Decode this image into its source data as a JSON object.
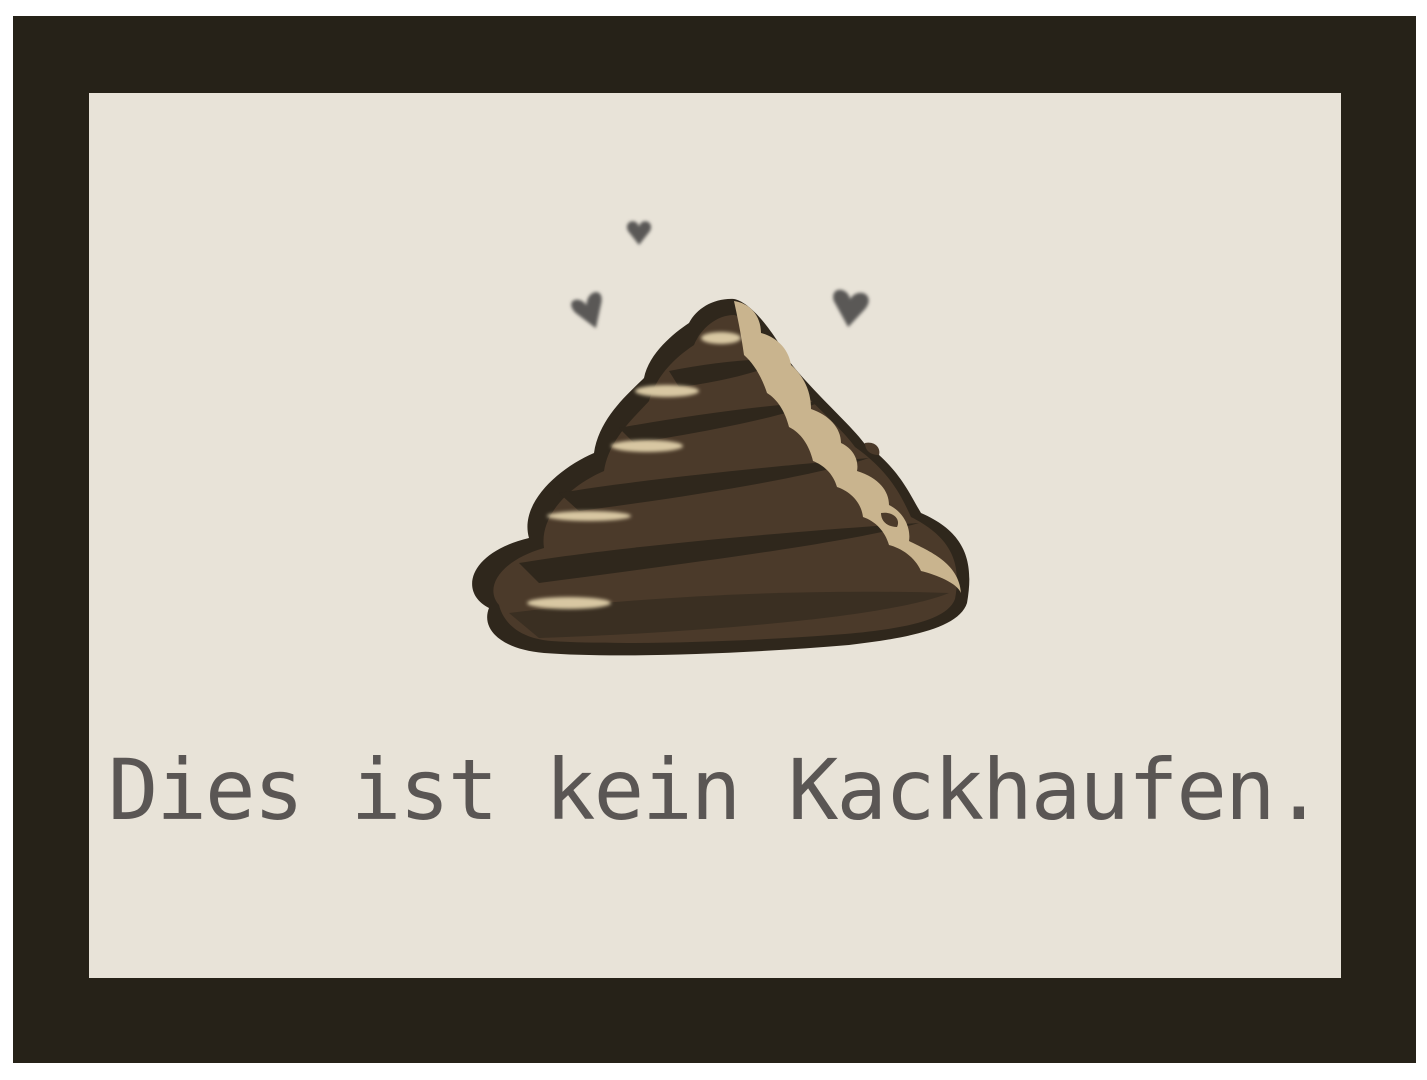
{
  "caption": "Dies ist kein Kackhaufen.",
  "icons": {
    "poop": "poop-icon",
    "hearts": [
      "heart-icon",
      "heart-icon",
      "heart-icon"
    ]
  },
  "colors": {
    "frame": "#262218",
    "card": "#e8e3d8",
    "poop_body": "#4b3a2a",
    "poop_shadow": "#2f271c",
    "poop_highlight": "#c9b48e",
    "hearts": "#5a5856",
    "caption_text": "#5a5654"
  }
}
